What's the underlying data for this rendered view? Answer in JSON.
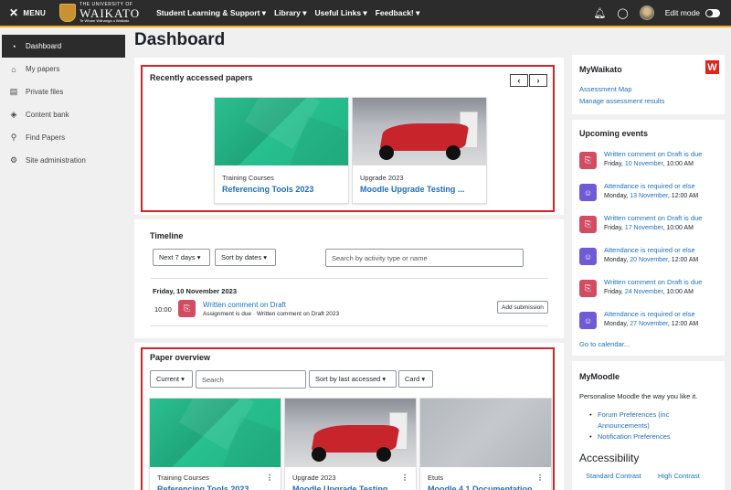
{
  "topbar": {
    "menu_label": "MENU",
    "logo": {
      "small": "THE UNIVERSITY OF",
      "big": "WAIKATO",
      "tag": "Te Whare Wānanga o Waikato"
    },
    "nav": [
      "Student Learning & Support ▾",
      "Library ▾",
      "Useful Links ▾",
      "Feedback! ▾"
    ],
    "edit_mode_label": "Edit mode"
  },
  "sidebar": {
    "items": [
      {
        "label": "Dashboard",
        "icon": "gauge-icon",
        "glyph": "◔",
        "active": true
      },
      {
        "label": "My papers",
        "icon": "graduation-cap-icon",
        "glyph": "⌂"
      },
      {
        "label": "Private files",
        "icon": "file-icon",
        "glyph": "▤"
      },
      {
        "label": "Content bank",
        "icon": "cube-icon",
        "glyph": "◈"
      },
      {
        "label": "Find Papers",
        "icon": "search-icon",
        "glyph": "⚲"
      },
      {
        "label": "Site administration",
        "icon": "gear-icon",
        "glyph": "⚙"
      }
    ]
  },
  "page_title": "Dashboard",
  "recent": {
    "title": "Recently accessed papers",
    "cards": [
      {
        "category": "Training Courses",
        "name": "Referencing Tools 2023"
      },
      {
        "category": "Upgrade 2023",
        "name": "Moodle Upgrade Testing ..."
      }
    ]
  },
  "timeline": {
    "title": "Timeline",
    "range_select": "Next 7 days",
    "sort_select": "Sort by dates",
    "search_placeholder": "Search by activity type or name",
    "date": "Friday, 10 November 2023",
    "time": "10:00",
    "item_link": "Written comment on Draft",
    "item_sub": "Assignment is due · Written comment on Draft 2023",
    "action": "Add submission"
  },
  "overview": {
    "title": "Paper overview",
    "filter": "Current",
    "search_placeholder": "Search",
    "sort": "Sort by last accessed",
    "view": "Card",
    "cards": [
      {
        "category": "Training Courses",
        "name": "Referencing Tools 2023"
      },
      {
        "category": "Upgrade 2023",
        "name": "Moodle Upgrade Testing"
      },
      {
        "category": "Etuts",
        "name": "Moodle 4.1 Documentation"
      }
    ]
  },
  "mywaikato": {
    "title": "MyWaikato",
    "logo": "W",
    "links": [
      "Assessment Map",
      "Manage assessment results"
    ]
  },
  "upcoming": {
    "title": "Upcoming events",
    "events": [
      {
        "name": "Written comment on Draft is due",
        "day": "Friday, ",
        "date_link": "10 November",
        "time": ", 10:00 AM",
        "type": "assign"
      },
      {
        "name": "Attendance is required or else",
        "day": "Monday, ",
        "date_link": "13 November",
        "time": ", 12:00 AM",
        "type": "attendance"
      },
      {
        "name": "Written comment on Draft is due",
        "day": "Friday, ",
        "date_link": "17 November",
        "time": ", 10:00 AM",
        "type": "assign"
      },
      {
        "name": "Attendance is required or else",
        "day": "Monday, ",
        "date_link": "20 November",
        "time": ", 12:00 AM",
        "type": "attendance"
      },
      {
        "name": "Written comment on Draft is due",
        "day": "Friday, ",
        "date_link": "24 November",
        "time": ", 10:00 AM",
        "type": "assign"
      },
      {
        "name": "Attendance is required or else",
        "day": "Monday, ",
        "date_link": "27 November",
        "time": ", 12:00 AM",
        "type": "attendance"
      }
    ],
    "calendar_link": "Go to calendar..."
  },
  "mymoodle": {
    "title": "MyMoodle",
    "intro": "Personalise Moodle the way you like it.",
    "links": [
      "Forum Preferences (inc Announcements)",
      "Notification Preferences"
    ],
    "accessibility_title": "Accessibility",
    "contrast": [
      "Standard Contrast",
      "High Contrast"
    ]
  }
}
